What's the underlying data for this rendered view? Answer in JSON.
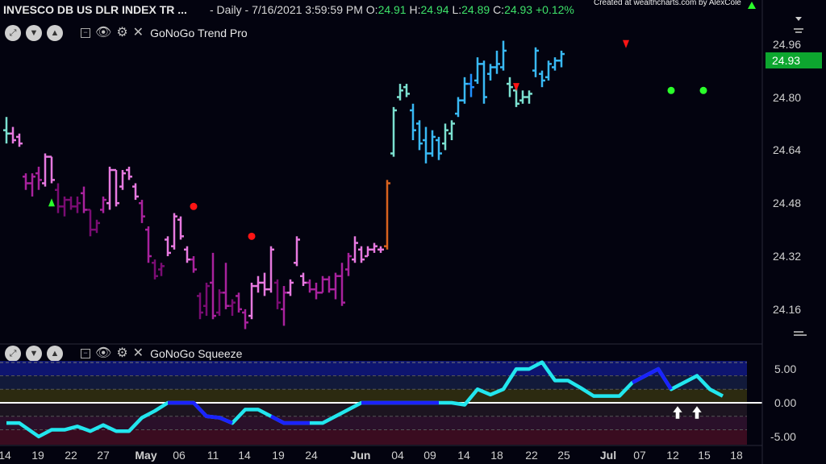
{
  "header": {
    "symbol": "INVESCO DB US DLR INDEX TR ...",
    "info": "- Daily - 7/16/2021 3:59:59 PM O:",
    "o": "24.91",
    "h_label": "H:",
    "h": "24.94",
    "l_label": "L:",
    "l": "24.89",
    "c_label": "C:",
    "c": "24.93",
    "chg": "+0.12%",
    "credit": "Created at wealthcharts.com by AlexCole"
  },
  "panels": {
    "trend": {
      "label": "GoNoGo Trend Pro",
      "collapse": "−"
    },
    "squeeze": {
      "label": "GoNoGo Squeeze",
      "collapse": "−"
    }
  },
  "price_tag": "24.93",
  "colors": {
    "background": "#03030f",
    "go_strong": "#1f8fff",
    "go_light": "#39b9f4",
    "go_weak": "#7be0d0",
    "nogo_strong": "#7a0c73",
    "nogo": "#a8229d",
    "nogo_weak": "#e679df",
    "amber": "#d8621e",
    "squeeze_line": "#22e6ee",
    "squeeze_max": "#1b22ff",
    "price_tag": "#0da62f"
  },
  "chart_data": [
    {
      "type": "ohlc",
      "title": "GoNoGo Trend Pro",
      "y_ticks": [
        "24.96",
        "24.80",
        "24.64",
        "24.48",
        "24.32",
        "24.16"
      ],
      "x_ticks": [
        "14",
        "19",
        "22",
        "27",
        "May",
        "06",
        "11",
        "14",
        "19",
        "24",
        "Jun",
        "04",
        "09",
        "14",
        "18",
        "22",
        "25",
        "Jul",
        "07",
        "12",
        "15",
        "18"
      ],
      "ylim": [
        24.06,
        25.02
      ],
      "bars": [
        {
          "o": 24.7,
          "h": 24.74,
          "l": 24.66,
          "c": 24.69,
          "k": "go_weak"
        },
        {
          "o": 24.69,
          "h": 24.71,
          "l": 24.66,
          "c": 24.67,
          "k": "nogo_weak"
        },
        {
          "o": 24.68,
          "h": 24.69,
          "l": 24.65,
          "c": 24.66,
          "k": "nogo_weak"
        },
        {
          "o": 24.56,
          "h": 24.57,
          "l": 24.52,
          "c": 24.54,
          "k": "nogo"
        },
        {
          "o": 24.54,
          "h": 24.57,
          "l": 24.5,
          "c": 24.56,
          "k": "nogo"
        },
        {
          "o": 24.57,
          "h": 24.59,
          "l": 24.52,
          "c": 24.55,
          "k": "nogo"
        },
        {
          "o": 24.54,
          "h": 24.63,
          "l": 24.53,
          "c": 24.62,
          "k": "nogo_weak"
        },
        {
          "o": 24.62,
          "h": 24.62,
          "l": 24.54,
          "c": 24.55,
          "k": "nogo_weak"
        },
        {
          "o": 24.52,
          "h": 24.54,
          "l": 24.45,
          "c": 24.47,
          "k": "nogo_strong"
        },
        {
          "o": 24.47,
          "h": 24.5,
          "l": 24.44,
          "c": 24.49,
          "k": "nogo_strong"
        },
        {
          "o": 24.49,
          "h": 24.5,
          "l": 24.46,
          "c": 24.47,
          "k": "nogo_strong"
        },
        {
          "o": 24.47,
          "h": 24.5,
          "l": 24.45,
          "c": 24.48,
          "k": "nogo_strong"
        },
        {
          "o": 24.51,
          "h": 24.53,
          "l": 24.45,
          "c": 24.46,
          "k": "nogo"
        },
        {
          "o": 24.46,
          "h": 24.46,
          "l": 24.38,
          "c": 24.4,
          "k": "nogo_strong"
        },
        {
          "o": 24.4,
          "h": 24.43,
          "l": 24.39,
          "c": 24.42,
          "k": "nogo_strong"
        },
        {
          "o": 24.46,
          "h": 24.5,
          "l": 24.45,
          "c": 24.49,
          "k": "nogo"
        },
        {
          "o": 24.48,
          "h": 24.59,
          "l": 24.46,
          "c": 24.58,
          "k": "nogo_weak"
        },
        {
          "o": 24.58,
          "h": 24.58,
          "l": 24.47,
          "c": 24.48,
          "k": "nogo_weak"
        },
        {
          "o": 24.53,
          "h": 24.58,
          "l": 24.52,
          "c": 24.57,
          "k": "nogo_weak"
        },
        {
          "o": 24.58,
          "h": 24.59,
          "l": 24.55,
          "c": 24.56,
          "k": "nogo_weak"
        },
        {
          "o": 24.53,
          "h": 24.54,
          "l": 24.49,
          "c": 24.5,
          "k": "nogo_weak"
        },
        {
          "o": 24.48,
          "h": 24.49,
          "l": 24.42,
          "c": 24.44,
          "k": "nogo"
        },
        {
          "o": 24.4,
          "h": 24.41,
          "l": 24.3,
          "c": 24.32,
          "k": "nogo"
        },
        {
          "o": 24.3,
          "h": 24.31,
          "l": 24.25,
          "c": 24.26,
          "k": "nogo_strong"
        },
        {
          "o": 24.28,
          "h": 24.3,
          "l": 24.26,
          "c": 24.29,
          "k": "nogo_strong"
        },
        {
          "o": 24.37,
          "h": 24.38,
          "l": 24.32,
          "c": 24.33,
          "k": "nogo_weak"
        },
        {
          "o": 24.35,
          "h": 24.45,
          "l": 24.34,
          "c": 24.44,
          "k": "nogo_weak"
        },
        {
          "o": 24.43,
          "h": 24.44,
          "l": 24.37,
          "c": 24.38,
          "k": "nogo_weak"
        },
        {
          "o": 24.34,
          "h": 24.35,
          "l": 24.3,
          "c": 24.31,
          "k": "nogo_weak"
        },
        {
          "o": 24.31,
          "h": 24.32,
          "l": 24.27,
          "c": 24.28,
          "k": "nogo"
        },
        {
          "o": 24.2,
          "h": 24.21,
          "l": 24.13,
          "c": 24.15,
          "k": "nogo_strong"
        },
        {
          "o": 24.17,
          "h": 24.24,
          "l": 24.14,
          "c": 24.23,
          "k": "nogo_strong"
        },
        {
          "o": 24.24,
          "h": 24.33,
          "l": 24.13,
          "c": 24.14,
          "k": "nogo"
        },
        {
          "o": 24.15,
          "h": 24.22,
          "l": 24.14,
          "c": 24.21,
          "k": "nogo_strong"
        },
        {
          "o": 24.21,
          "h": 24.3,
          "l": 24.16,
          "c": 24.17,
          "k": "nogo"
        },
        {
          "o": 24.17,
          "h": 24.19,
          "l": 24.14,
          "c": 24.18,
          "k": "nogo_strong"
        },
        {
          "o": 24.2,
          "h": 24.21,
          "l": 24.15,
          "c": 24.16,
          "k": "nogo"
        },
        {
          "o": 24.15,
          "h": 24.16,
          "l": 24.1,
          "c": 24.12,
          "k": "nogo"
        },
        {
          "o": 24.14,
          "h": 24.24,
          "l": 24.13,
          "c": 24.23,
          "k": "nogo_weak"
        },
        {
          "o": 24.23,
          "h": 24.26,
          "l": 24.21,
          "c": 24.24,
          "k": "nogo_weak"
        },
        {
          "o": 24.24,
          "h": 24.27,
          "l": 24.2,
          "c": 24.22,
          "k": "nogo_weak"
        },
        {
          "o": 24.22,
          "h": 24.35,
          "l": 24.21,
          "c": 24.34,
          "k": "nogo_weak"
        },
        {
          "o": 24.24,
          "h": 24.25,
          "l": 24.16,
          "c": 24.18,
          "k": "nogo_strong"
        },
        {
          "o": 24.16,
          "h": 24.23,
          "l": 24.11,
          "c": 24.21,
          "k": "nogo"
        },
        {
          "o": 24.21,
          "h": 24.25,
          "l": 24.2,
          "c": 24.24,
          "k": "nogo_weak"
        },
        {
          "o": 24.3,
          "h": 24.38,
          "l": 24.29,
          "c": 24.37,
          "k": "nogo_weak"
        },
        {
          "o": 24.26,
          "h": 24.27,
          "l": 24.23,
          "c": 24.24,
          "k": "nogo_weak"
        },
        {
          "o": 24.24,
          "h": 24.25,
          "l": 24.21,
          "c": 24.22,
          "k": "nogo"
        },
        {
          "o": 24.22,
          "h": 24.24,
          "l": 24.19,
          "c": 24.21,
          "k": "nogo"
        },
        {
          "o": 24.21,
          "h": 24.26,
          "l": 24.21,
          "c": 24.25,
          "k": "nogo"
        },
        {
          "o": 24.25,
          "h": 24.26,
          "l": 24.21,
          "c": 24.22,
          "k": "nogo"
        },
        {
          "o": 24.22,
          "h": 24.27,
          "l": 24.19,
          "c": 24.26,
          "k": "nogo"
        },
        {
          "o": 24.26,
          "h": 24.3,
          "l": 24.17,
          "c": 24.18,
          "k": "nogo"
        },
        {
          "o": 24.28,
          "h": 24.33,
          "l": 24.26,
          "c": 24.32,
          "k": "nogo"
        },
        {
          "o": 24.31,
          "h": 24.38,
          "l": 24.3,
          "c": 24.36,
          "k": "nogo_weak"
        },
        {
          "o": 24.34,
          "h": 24.35,
          "l": 24.3,
          "c": 24.31,
          "k": "nogo_weak"
        },
        {
          "o": 24.32,
          "h": 24.35,
          "l": 24.32,
          "c": 24.34,
          "k": "nogo_weak"
        },
        {
          "o": 24.34,
          "h": 24.36,
          "l": 24.33,
          "c": 24.35,
          "k": "nogo_weak"
        },
        {
          "o": 24.34,
          "h": 24.35,
          "l": 24.33,
          "c": 24.34,
          "k": "nogo_weak"
        },
        {
          "o": 24.35,
          "h": 24.55,
          "l": 24.34,
          "c": 24.54,
          "k": "amber"
        },
        {
          "o": 24.63,
          "h": 24.77,
          "l": 24.62,
          "c": 24.76,
          "k": "go_weak"
        },
        {
          "o": 24.8,
          "h": 24.84,
          "l": 24.79,
          "c": 24.82,
          "k": "go_weak"
        },
        {
          "o": 24.83,
          "h": 24.84,
          "l": 24.8,
          "c": 24.81,
          "k": "go_weak"
        },
        {
          "o": 24.76,
          "h": 24.78,
          "l": 24.67,
          "c": 24.7,
          "k": "go_light"
        },
        {
          "o": 24.72,
          "h": 24.73,
          "l": 24.64,
          "c": 24.66,
          "k": "go_light"
        },
        {
          "o": 24.67,
          "h": 24.71,
          "l": 24.6,
          "c": 24.63,
          "k": "go_light"
        },
        {
          "o": 24.63,
          "h": 24.7,
          "l": 24.62,
          "c": 24.68,
          "k": "go_light"
        },
        {
          "o": 24.67,
          "h": 24.68,
          "l": 24.61,
          "c": 24.63,
          "k": "go_light"
        },
        {
          "o": 24.66,
          "h": 24.72,
          "l": 24.64,
          "c": 24.7,
          "k": "go_weak"
        },
        {
          "o": 24.69,
          "h": 24.73,
          "l": 24.67,
          "c": 24.72,
          "k": "go_weak"
        },
        {
          "o": 24.75,
          "h": 24.8,
          "l": 24.74,
          "c": 24.79,
          "k": "go_light"
        },
        {
          "o": 24.79,
          "h": 24.86,
          "l": 24.78,
          "c": 24.84,
          "k": "go_light"
        },
        {
          "o": 24.84,
          "h": 24.87,
          "l": 24.8,
          "c": 24.83,
          "k": "go_strong"
        },
        {
          "o": 24.85,
          "h": 24.92,
          "l": 24.84,
          "c": 24.9,
          "k": "go_light"
        },
        {
          "o": 24.9,
          "h": 24.91,
          "l": 24.78,
          "c": 24.8,
          "k": "go_light"
        },
        {
          "o": 24.87,
          "h": 24.9,
          "l": 24.85,
          "c": 24.89,
          "k": "go_light"
        },
        {
          "o": 24.89,
          "h": 24.94,
          "l": 24.87,
          "c": 24.9,
          "k": "go_light"
        },
        {
          "o": 24.89,
          "h": 24.97,
          "l": 24.88,
          "c": 24.94,
          "k": "go_light"
        },
        {
          "o": 24.84,
          "h": 24.86,
          "l": 24.8,
          "c": 24.83,
          "k": "go_weak"
        },
        {
          "o": 24.82,
          "h": 24.83,
          "l": 24.77,
          "c": 24.78,
          "k": "go_weak"
        },
        {
          "o": 24.79,
          "h": 24.82,
          "l": 24.78,
          "c": 24.8,
          "k": "go_weak"
        },
        {
          "o": 24.8,
          "h": 24.82,
          "l": 24.78,
          "c": 24.81,
          "k": "go_weak"
        },
        {
          "o": 24.88,
          "h": 24.95,
          "l": 24.86,
          "c": 24.94,
          "k": "go_light"
        },
        {
          "o": 24.87,
          "h": 24.88,
          "l": 24.83,
          "c": 24.85,
          "k": "go_light"
        },
        {
          "o": 24.86,
          "h": 24.91,
          "l": 24.85,
          "c": 24.9,
          "k": "go_light"
        },
        {
          "o": 24.89,
          "h": 24.92,
          "l": 24.88,
          "c": 24.91,
          "k": "go_light"
        },
        {
          "o": 24.91,
          "h": 24.94,
          "l": 24.89,
          "c": 24.93,
          "k": "go_light"
        }
      ],
      "markers": [
        {
          "i": 7,
          "type": "green-triangle-up",
          "level": 24.48
        },
        {
          "i": 29,
          "type": "red-dot",
          "level": 24.47
        },
        {
          "i": 38,
          "type": "red-dot",
          "level": 24.38
        },
        {
          "i": 79,
          "type": "red-triangle-down",
          "level": 24.83
        },
        {
          "i": 96,
          "type": "red-triangle-down",
          "level": 24.96
        },
        {
          "i": 103,
          "type": "green-dot",
          "level": 24.82
        },
        {
          "i": 108,
          "type": "green-dot",
          "level": 24.82
        }
      ],
      "top_right_marker": "green-triangle-up"
    },
    {
      "type": "line",
      "title": "GoNoGo Squeeze",
      "y_ticks": [
        "5.00",
        "0.00",
        "-5.00"
      ],
      "ylim": [
        -6.2,
        6.2
      ],
      "zero_level": 0,
      "x": [
        0,
        2,
        5,
        7,
        9,
        11,
        13,
        15,
        17,
        19,
        21,
        23,
        25,
        27,
        29,
        31,
        33,
        35,
        37,
        39,
        41,
        43,
        45,
        47,
        49,
        51,
        53,
        55,
        57,
        59,
        61,
        63,
        65,
        67,
        69,
        71,
        73,
        75,
        77,
        79,
        81,
        83,
        85,
        87,
        89,
        91,
        93,
        95,
        97,
        99,
        101,
        103,
        105,
        107,
        109,
        111
      ],
      "values": [
        -3.0,
        -3.0,
        -5.0,
        -4.0,
        -4.0,
        -3.5,
        -4.2,
        -3.3,
        -4.2,
        -4.2,
        -2.2,
        -1.2,
        0,
        0,
        0,
        -2.0,
        -2.2,
        -3.0,
        -1.0,
        -1.0,
        -2.0,
        -3.0,
        -3.0,
        -3.0,
        -3.0,
        -2.0,
        -1.0,
        0,
        0,
        0,
        0,
        0,
        0,
        0,
        0,
        -0.3,
        2.0,
        1.2,
        2.0,
        5.0,
        5.0,
        6.0,
        3.3,
        3.3,
        2.2,
        1.0,
        1.0,
        1.0,
        3.0,
        4.0,
        5.0,
        2.0,
        3.0,
        4.0,
        2.0,
        1.0
      ],
      "max_segments": [
        [
          25,
          35
        ],
        [
          40,
          47
        ],
        [
          55,
          68
        ],
        [
          96,
          104
        ]
      ],
      "arrows": [
        {
          "i": 104,
          "type": "white-arrow-up"
        },
        {
          "i": 107,
          "type": "white-arrow-up"
        }
      ]
    }
  ]
}
